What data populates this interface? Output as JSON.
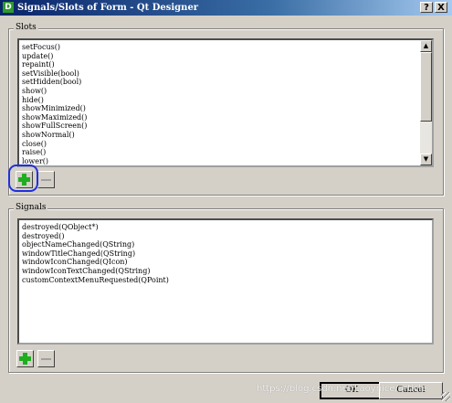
{
  "window": {
    "icon_letter": "D",
    "title": "Signals/Slots of Form - Qt Designer",
    "help_label": "?",
    "close_label": "X"
  },
  "slots": {
    "label": "Slots",
    "items": [
      "setFocus()",
      "update()",
      "repaint()",
      "setVisible(bool)",
      "setHidden(bool)",
      "show()",
      "hide()",
      "showMinimized()",
      "showMaximized()",
      "showFullScreen()",
      "showNormal()",
      "close()",
      "raise()",
      "lower()"
    ],
    "scroll_up_glyph": "▲",
    "scroll_down_glyph": "▼"
  },
  "signals": {
    "label": "Signals",
    "items": [
      "destroyed(QObject*)",
      "destroyed()",
      "objectNameChanged(QString)",
      "windowTitleChanged(QString)",
      "windowIconChanged(QIcon)",
      "windowIconTextChanged(QString)",
      "customContextMenuRequested(QPoint)"
    ]
  },
  "buttons": {
    "ok": "OK",
    "cancel": "Cancel"
  },
  "watermark": "https://blog.csdn.net/Laoynice/article",
  "colors": {
    "title_start": "#0a246a",
    "title_end": "#a6caf0",
    "plus_green": "#1fae1f",
    "highlight_ring": "#2030e0"
  }
}
